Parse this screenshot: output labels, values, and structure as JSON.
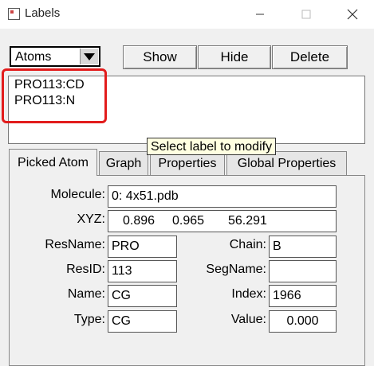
{
  "window": {
    "title": "Labels"
  },
  "toolbar": {
    "category_select": "Atoms",
    "show_label": "Show",
    "hide_label": "Hide",
    "delete_label": "Delete"
  },
  "labels_list": [
    "PRO113:CD",
    "PRO113:N"
  ],
  "tooltip": "Select label to modify",
  "tabs": [
    "Picked Atom",
    "Graph",
    "Properties",
    "Global Properties"
  ],
  "picked_atom": {
    "molecule_label": "Molecule:",
    "molecule": "0: 4x51.pdb",
    "xyz_label": "XYZ:",
    "xyz": [
      "0.896",
      "0.965",
      "56.291"
    ],
    "resname_label": "ResName:",
    "resname": "PRO",
    "chain_label": "Chain:",
    "chain": "B",
    "resid_label": "ResID:",
    "resid": "113",
    "segname_label": "SegName:",
    "segname": "",
    "name_label": "Name:",
    "name": "CG",
    "index_label": "Index:",
    "index": "1966",
    "type_label": "Type:",
    "type": "CG",
    "value_label": "Value:",
    "value": "0.000"
  },
  "colors": {
    "highlight": "#e21c1c",
    "tooltip_bg": "#ffffe1"
  }
}
